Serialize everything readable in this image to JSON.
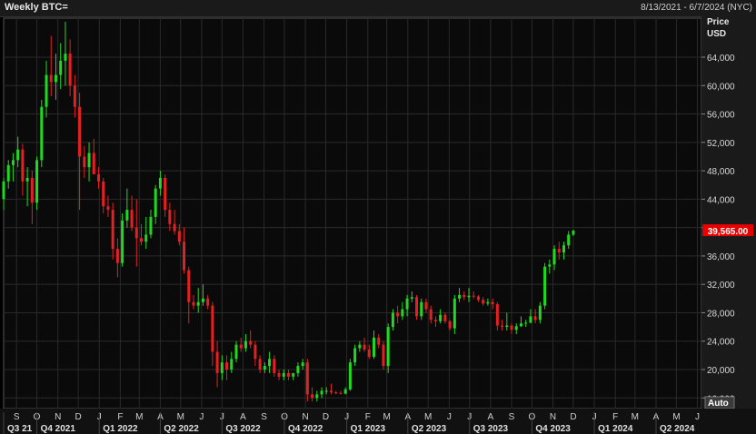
{
  "header": {
    "title": "Weekly BTC=",
    "date_range": "8/13/2021 - 6/7/2024 (NYC)"
  },
  "axis": {
    "price_label": "Price",
    "currency_label": "USD",
    "auto_label": "Auto",
    "last_price_label": "39,565.00"
  },
  "colors": {
    "background": "#000000",
    "plot_bg": "#0a0a0a",
    "grid": "#2a2a2a",
    "up": "#21d821",
    "down": "#e62020",
    "axis_bg": "#1a1a1a",
    "price_tag": "#e60000"
  },
  "chart_data": {
    "type": "candlestick",
    "title": "Weekly BTC=",
    "ylabel": "Price USD",
    "ylim": [
      14500,
      69500
    ],
    "y_ticks": [
      16000,
      20000,
      24000,
      28000,
      32000,
      36000,
      40000,
      44000,
      48000,
      52000,
      56000,
      60000,
      64000
    ],
    "y_tick_labels": [
      "16,000",
      "20,000",
      "24,000",
      "28,000",
      "32,000",
      "36,000",
      "40,000",
      "44,000",
      "48,000",
      "52,000",
      "56,000",
      "60,000",
      "64,000"
    ],
    "x_start": "2021-08-13",
    "x_end": "2024-06-07",
    "month_labels": [
      {
        "date": "2021-09-01",
        "label": "S"
      },
      {
        "date": "2021-10-01",
        "label": "O"
      },
      {
        "date": "2021-11-01",
        "label": "N"
      },
      {
        "date": "2021-12-01",
        "label": "D"
      },
      {
        "date": "2022-01-01",
        "label": "J"
      },
      {
        "date": "2022-02-01",
        "label": "F"
      },
      {
        "date": "2022-03-01",
        "label": "M"
      },
      {
        "date": "2022-04-01",
        "label": "A"
      },
      {
        "date": "2022-05-01",
        "label": "M"
      },
      {
        "date": "2022-06-01",
        "label": "J"
      },
      {
        "date": "2022-07-01",
        "label": "J"
      },
      {
        "date": "2022-08-01",
        "label": "A"
      },
      {
        "date": "2022-09-01",
        "label": "S"
      },
      {
        "date": "2022-10-01",
        "label": "O"
      },
      {
        "date": "2022-11-01",
        "label": "N"
      },
      {
        "date": "2022-12-01",
        "label": "D"
      },
      {
        "date": "2023-01-01",
        "label": "J"
      },
      {
        "date": "2023-02-01",
        "label": "F"
      },
      {
        "date": "2023-03-01",
        "label": "M"
      },
      {
        "date": "2023-04-01",
        "label": "A"
      },
      {
        "date": "2023-05-01",
        "label": "M"
      },
      {
        "date": "2023-06-01",
        "label": "J"
      },
      {
        "date": "2023-07-01",
        "label": "J"
      },
      {
        "date": "2023-08-01",
        "label": "A"
      },
      {
        "date": "2023-09-01",
        "label": "S"
      },
      {
        "date": "2023-10-01",
        "label": "O"
      },
      {
        "date": "2023-11-01",
        "label": "N"
      },
      {
        "date": "2023-12-01",
        "label": "D"
      },
      {
        "date": "2024-01-01",
        "label": "J"
      },
      {
        "date": "2024-02-01",
        "label": "F"
      },
      {
        "date": "2024-03-01",
        "label": "M"
      },
      {
        "date": "2024-04-01",
        "label": "A"
      },
      {
        "date": "2024-05-01",
        "label": "M"
      },
      {
        "date": "2024-06-01",
        "label": "J"
      }
    ],
    "quarter_labels": [
      {
        "date": "2021-08-13",
        "label": "Q3 21"
      },
      {
        "date": "2021-10-01",
        "label": "Q4 2021"
      },
      {
        "date": "2022-01-01",
        "label": "Q1 2022"
      },
      {
        "date": "2022-04-01",
        "label": "Q2 2022"
      },
      {
        "date": "2022-07-01",
        "label": "Q3 2022"
      },
      {
        "date": "2022-10-01",
        "label": "Q4 2022"
      },
      {
        "date": "2023-01-01",
        "label": "Q1 2023"
      },
      {
        "date": "2023-04-01",
        "label": "Q2 2023"
      },
      {
        "date": "2023-07-01",
        "label": "Q3 2023"
      },
      {
        "date": "2023-10-01",
        "label": "Q4 2023"
      },
      {
        "date": "2024-01-01",
        "label": "Q1 2024"
      },
      {
        "date": "2024-04-01",
        "label": "Q2 2024"
      }
    ],
    "last_price": 39565,
    "candles": [
      {
        "date": "2021-08-13",
        "o": 44000,
        "h": 47000,
        "l": 42500,
        "c": 46500
      },
      {
        "date": "2021-08-20",
        "o": 46500,
        "h": 49500,
        "l": 45500,
        "c": 48800
      },
      {
        "date": "2021-08-27",
        "o": 48800,
        "h": 50500,
        "l": 46500,
        "c": 49500
      },
      {
        "date": "2021-09-03",
        "o": 49500,
        "h": 52800,
        "l": 48500,
        "c": 51000
      },
      {
        "date": "2021-09-10",
        "o": 51000,
        "h": 51800,
        "l": 44500,
        "c": 46500
      },
      {
        "date": "2021-09-17",
        "o": 46500,
        "h": 48500,
        "l": 43000,
        "c": 47000
      },
      {
        "date": "2021-09-24",
        "o": 47000,
        "h": 48000,
        "l": 40500,
        "c": 43500
      },
      {
        "date": "2021-10-01",
        "o": 43500,
        "h": 50000,
        "l": 42500,
        "c": 49500
      },
      {
        "date": "2021-10-08",
        "o": 49500,
        "h": 58000,
        "l": 48500,
        "c": 57000
      },
      {
        "date": "2021-10-15",
        "o": 57000,
        "h": 63500,
        "l": 55500,
        "c": 61500
      },
      {
        "date": "2021-10-22",
        "o": 61500,
        "h": 67000,
        "l": 58500,
        "c": 60500
      },
      {
        "date": "2021-10-29",
        "o": 60500,
        "h": 64500,
        "l": 58000,
        "c": 61500
      },
      {
        "date": "2021-11-05",
        "o": 61500,
        "h": 66000,
        "l": 59500,
        "c": 63500
      },
      {
        "date": "2021-11-12",
        "o": 63500,
        "h": 69000,
        "l": 60000,
        "c": 64500
      },
      {
        "date": "2021-11-19",
        "o": 64500,
        "h": 66500,
        "l": 58500,
        "c": 60000
      },
      {
        "date": "2021-11-26",
        "o": 60000,
        "h": 61500,
        "l": 55500,
        "c": 57000
      },
      {
        "date": "2021-12-03",
        "o": 57000,
        "h": 59000,
        "l": 42500,
        "c": 50000
      },
      {
        "date": "2021-12-10",
        "o": 50000,
        "h": 51500,
        "l": 47000,
        "c": 48500
      },
      {
        "date": "2021-12-17",
        "o": 48500,
        "h": 52000,
        "l": 46500,
        "c": 50500
      },
      {
        "date": "2021-12-24",
        "o": 50500,
        "h": 52500,
        "l": 47500,
        "c": 47500
      },
      {
        "date": "2021-12-31",
        "o": 47500,
        "h": 48500,
        "l": 45500,
        "c": 46500
      },
      {
        "date": "2022-01-07",
        "o": 46500,
        "h": 47000,
        "l": 42000,
        "c": 43000
      },
      {
        "date": "2022-01-14",
        "o": 43000,
        "h": 44500,
        "l": 41500,
        "c": 42500
      },
      {
        "date": "2022-01-21",
        "o": 42500,
        "h": 43500,
        "l": 35500,
        "c": 37000
      },
      {
        "date": "2022-01-28",
        "o": 37000,
        "h": 38500,
        "l": 33000,
        "c": 35000
      },
      {
        "date": "2022-02-04",
        "o": 35000,
        "h": 42000,
        "l": 34500,
        "c": 41000
      },
      {
        "date": "2022-02-11",
        "o": 41000,
        "h": 45500,
        "l": 40000,
        "c": 42500
      },
      {
        "date": "2022-02-18",
        "o": 42500,
        "h": 44500,
        "l": 39500,
        "c": 40000
      },
      {
        "date": "2022-02-25",
        "o": 40000,
        "h": 44000,
        "l": 34500,
        "c": 38500
      },
      {
        "date": "2022-03-04",
        "o": 38500,
        "h": 40500,
        "l": 37500,
        "c": 38000
      },
      {
        "date": "2022-03-11",
        "o": 38000,
        "h": 41500,
        "l": 37000,
        "c": 39000
      },
      {
        "date": "2022-03-18",
        "o": 39000,
        "h": 42500,
        "l": 38500,
        "c": 41500
      },
      {
        "date": "2022-03-25",
        "o": 41500,
        "h": 46000,
        "l": 40500,
        "c": 45500
      },
      {
        "date": "2022-04-01",
        "o": 45500,
        "h": 48000,
        "l": 44500,
        "c": 47000
      },
      {
        "date": "2022-04-08",
        "o": 47000,
        "h": 47500,
        "l": 41500,
        "c": 42500
      },
      {
        "date": "2022-04-15",
        "o": 42500,
        "h": 43500,
        "l": 39500,
        "c": 40500
      },
      {
        "date": "2022-04-22",
        "o": 40500,
        "h": 42500,
        "l": 39000,
        "c": 39500
      },
      {
        "date": "2022-04-29",
        "o": 39500,
        "h": 40500,
        "l": 37500,
        "c": 38000
      },
      {
        "date": "2022-05-06",
        "o": 38000,
        "h": 40000,
        "l": 33500,
        "c": 34000
      },
      {
        "date": "2022-05-13",
        "o": 34000,
        "h": 34500,
        "l": 26500,
        "c": 29500
      },
      {
        "date": "2022-05-20",
        "o": 29500,
        "h": 30500,
        "l": 28500,
        "c": 29000
      },
      {
        "date": "2022-05-27",
        "o": 29000,
        "h": 31500,
        "l": 28000,
        "c": 29500
      },
      {
        "date": "2022-06-03",
        "o": 29500,
        "h": 32000,
        "l": 29000,
        "c": 30000
      },
      {
        "date": "2022-06-10",
        "o": 30000,
        "h": 30500,
        "l": 28500,
        "c": 29000
      },
      {
        "date": "2022-06-17",
        "o": 29000,
        "h": 29500,
        "l": 20500,
        "c": 22500
      },
      {
        "date": "2022-06-24",
        "o": 22500,
        "h": 24000,
        "l": 17500,
        "c": 19500
      },
      {
        "date": "2022-07-01",
        "o": 19500,
        "h": 22000,
        "l": 18500,
        "c": 21000
      },
      {
        "date": "2022-07-08",
        "o": 21000,
        "h": 22000,
        "l": 18500,
        "c": 20000
      },
      {
        "date": "2022-07-15",
        "o": 20000,
        "h": 22500,
        "l": 19500,
        "c": 21500
      },
      {
        "date": "2022-07-22",
        "o": 21500,
        "h": 24000,
        "l": 21000,
        "c": 23500
      },
      {
        "date": "2022-07-29",
        "o": 23500,
        "h": 24500,
        "l": 22500,
        "c": 23000
      },
      {
        "date": "2022-08-05",
        "o": 23000,
        "h": 25000,
        "l": 22500,
        "c": 24000
      },
      {
        "date": "2022-08-12",
        "o": 24000,
        "h": 25500,
        "l": 23000,
        "c": 23500
      },
      {
        "date": "2022-08-19",
        "o": 23500,
        "h": 24000,
        "l": 20500,
        "c": 21500
      },
      {
        "date": "2022-08-26",
        "o": 21500,
        "h": 22000,
        "l": 19500,
        "c": 20000
      },
      {
        "date": "2022-09-02",
        "o": 20000,
        "h": 21000,
        "l": 19500,
        "c": 20500
      },
      {
        "date": "2022-09-09",
        "o": 20500,
        "h": 22500,
        "l": 19500,
        "c": 21500
      },
      {
        "date": "2022-09-16",
        "o": 21500,
        "h": 22000,
        "l": 19000,
        "c": 19500
      },
      {
        "date": "2022-09-23",
        "o": 19500,
        "h": 20000,
        "l": 18500,
        "c": 19000
      },
      {
        "date": "2022-09-30",
        "o": 19000,
        "h": 20000,
        "l": 18500,
        "c": 19500
      },
      {
        "date": "2022-10-07",
        "o": 19500,
        "h": 20000,
        "l": 18500,
        "c": 19000
      },
      {
        "date": "2022-10-14",
        "o": 19000,
        "h": 19500,
        "l": 18500,
        "c": 19500
      },
      {
        "date": "2022-10-21",
        "o": 19500,
        "h": 21000,
        "l": 19000,
        "c": 20500
      },
      {
        "date": "2022-10-28",
        "o": 20500,
        "h": 21500,
        "l": 20000,
        "c": 21000
      },
      {
        "date": "2022-11-04",
        "o": 21000,
        "h": 21500,
        "l": 15500,
        "c": 16500
      },
      {
        "date": "2022-11-11",
        "o": 16500,
        "h": 17500,
        "l": 15500,
        "c": 16000
      },
      {
        "date": "2022-11-18",
        "o": 16000,
        "h": 17000,
        "l": 15500,
        "c": 16500
      },
      {
        "date": "2022-11-25",
        "o": 16500,
        "h": 17500,
        "l": 16000,
        "c": 17000
      },
      {
        "date": "2022-12-02",
        "o": 17000,
        "h": 17500,
        "l": 16500,
        "c": 17000
      },
      {
        "date": "2022-12-09",
        "o": 17000,
        "h": 18000,
        "l": 16500,
        "c": 16800
      },
      {
        "date": "2022-12-16",
        "o": 16800,
        "h": 17000,
        "l": 16500,
        "c": 16700
      },
      {
        "date": "2022-12-23",
        "o": 16700,
        "h": 17000,
        "l": 16500,
        "c": 16600
      },
      {
        "date": "2022-12-30",
        "o": 16600,
        "h": 17500,
        "l": 16500,
        "c": 17200
      },
      {
        "date": "2023-01-06",
        "o": 17200,
        "h": 21500,
        "l": 17000,
        "c": 21000
      },
      {
        "date": "2023-01-13",
        "o": 21000,
        "h": 23500,
        "l": 20500,
        "c": 23000
      },
      {
        "date": "2023-01-20",
        "o": 23000,
        "h": 24000,
        "l": 22500,
        "c": 23500
      },
      {
        "date": "2023-01-27",
        "o": 23500,
        "h": 24500,
        "l": 22500,
        "c": 22800
      },
      {
        "date": "2023-02-03",
        "o": 22800,
        "h": 23500,
        "l": 21500,
        "c": 21800
      },
      {
        "date": "2023-02-10",
        "o": 21800,
        "h": 25500,
        "l": 21500,
        "c": 24500
      },
      {
        "date": "2023-02-17",
        "o": 24500,
        "h": 25000,
        "l": 23000,
        "c": 23500
      },
      {
        "date": "2023-02-24",
        "o": 23500,
        "h": 24000,
        "l": 20000,
        "c": 20500
      },
      {
        "date": "2023-03-03",
        "o": 20500,
        "h": 26500,
        "l": 19500,
        "c": 26000
      },
      {
        "date": "2023-03-10",
        "o": 26000,
        "h": 28500,
        "l": 25500,
        "c": 28000
      },
      {
        "date": "2023-03-17",
        "o": 28000,
        "h": 29000,
        "l": 26500,
        "c": 27500
      },
      {
        "date": "2023-03-24",
        "o": 27500,
        "h": 29500,
        "l": 27000,
        "c": 28500
      },
      {
        "date": "2023-03-31",
        "o": 28500,
        "h": 30500,
        "l": 27500,
        "c": 30000
      },
      {
        "date": "2023-04-07",
        "o": 30000,
        "h": 31000,
        "l": 29500,
        "c": 30200
      },
      {
        "date": "2023-04-14",
        "o": 30200,
        "h": 30500,
        "l": 27000,
        "c": 27500
      },
      {
        "date": "2023-04-21",
        "o": 27500,
        "h": 30000,
        "l": 27000,
        "c": 29500
      },
      {
        "date": "2023-04-28",
        "o": 29500,
        "h": 30000,
        "l": 28000,
        "c": 28500
      },
      {
        "date": "2023-05-05",
        "o": 28500,
        "h": 29000,
        "l": 26500,
        "c": 27000
      },
      {
        "date": "2023-05-12",
        "o": 27000,
        "h": 27500,
        "l": 26000,
        "c": 26800
      },
      {
        "date": "2023-05-19",
        "o": 26800,
        "h": 28500,
        "l": 26500,
        "c": 27700
      },
      {
        "date": "2023-05-26",
        "o": 27700,
        "h": 28000,
        "l": 26500,
        "c": 26800
      },
      {
        "date": "2023-06-02",
        "o": 26800,
        "h": 27000,
        "l": 25500,
        "c": 25800
      },
      {
        "date": "2023-06-09",
        "o": 25800,
        "h": 30500,
        "l": 25000,
        "c": 30000
      },
      {
        "date": "2023-06-16",
        "o": 30000,
        "h": 31500,
        "l": 29500,
        "c": 30500
      },
      {
        "date": "2023-06-23",
        "o": 30500,
        "h": 31000,
        "l": 29800,
        "c": 30200
      },
      {
        "date": "2023-06-30",
        "o": 30200,
        "h": 31500,
        "l": 29500,
        "c": 30400
      },
      {
        "date": "2023-07-07",
        "o": 30400,
        "h": 31000,
        "l": 30000,
        "c": 30300
      },
      {
        "date": "2023-07-14",
        "o": 30300,
        "h": 30500,
        "l": 29500,
        "c": 29800
      },
      {
        "date": "2023-07-21",
        "o": 29800,
        "h": 30200,
        "l": 29000,
        "c": 29300
      },
      {
        "date": "2023-07-28",
        "o": 29300,
        "h": 30000,
        "l": 29000,
        "c": 29500
      },
      {
        "date": "2023-08-04",
        "o": 29500,
        "h": 30000,
        "l": 28500,
        "c": 29200
      },
      {
        "date": "2023-08-11",
        "o": 29200,
        "h": 29500,
        "l": 25500,
        "c": 26200
      },
      {
        "date": "2023-08-18",
        "o": 26200,
        "h": 27000,
        "l": 25500,
        "c": 26000
      },
      {
        "date": "2023-08-25",
        "o": 26000,
        "h": 28000,
        "l": 25500,
        "c": 26200
      },
      {
        "date": "2023-09-01",
        "o": 26200,
        "h": 26500,
        "l": 25000,
        "c": 25600
      },
      {
        "date": "2023-09-08",
        "o": 25600,
        "h": 26500,
        "l": 25000,
        "c": 26100
      },
      {
        "date": "2023-09-15",
        "o": 26100,
        "h": 27500,
        "l": 26000,
        "c": 26500
      },
      {
        "date": "2023-09-22",
        "o": 26500,
        "h": 27000,
        "l": 26000,
        "c": 26600
      },
      {
        "date": "2023-09-29",
        "o": 26600,
        "h": 28500,
        "l": 26500,
        "c": 27500
      },
      {
        "date": "2023-10-06",
        "o": 27500,
        "h": 28500,
        "l": 26500,
        "c": 27000
      },
      {
        "date": "2023-10-13",
        "o": 27000,
        "h": 29500,
        "l": 26500,
        "c": 29000
      },
      {
        "date": "2023-10-20",
        "o": 29000,
        "h": 35000,
        "l": 28500,
        "c": 34500
      },
      {
        "date": "2023-10-27",
        "o": 34500,
        "h": 35500,
        "l": 33500,
        "c": 34800
      },
      {
        "date": "2023-11-03",
        "o": 34800,
        "h": 37500,
        "l": 34000,
        "c": 37000
      },
      {
        "date": "2023-11-10",
        "o": 37000,
        "h": 38000,
        "l": 35500,
        "c": 36500
      },
      {
        "date": "2023-11-17",
        "o": 36500,
        "h": 38000,
        "l": 35500,
        "c": 37500
      },
      {
        "date": "2023-11-24",
        "o": 37500,
        "h": 39500,
        "l": 37000,
        "c": 39000
      },
      {
        "date": "2023-12-01",
        "o": 39000,
        "h": 39700,
        "l": 38800,
        "c": 39565
      }
    ]
  }
}
